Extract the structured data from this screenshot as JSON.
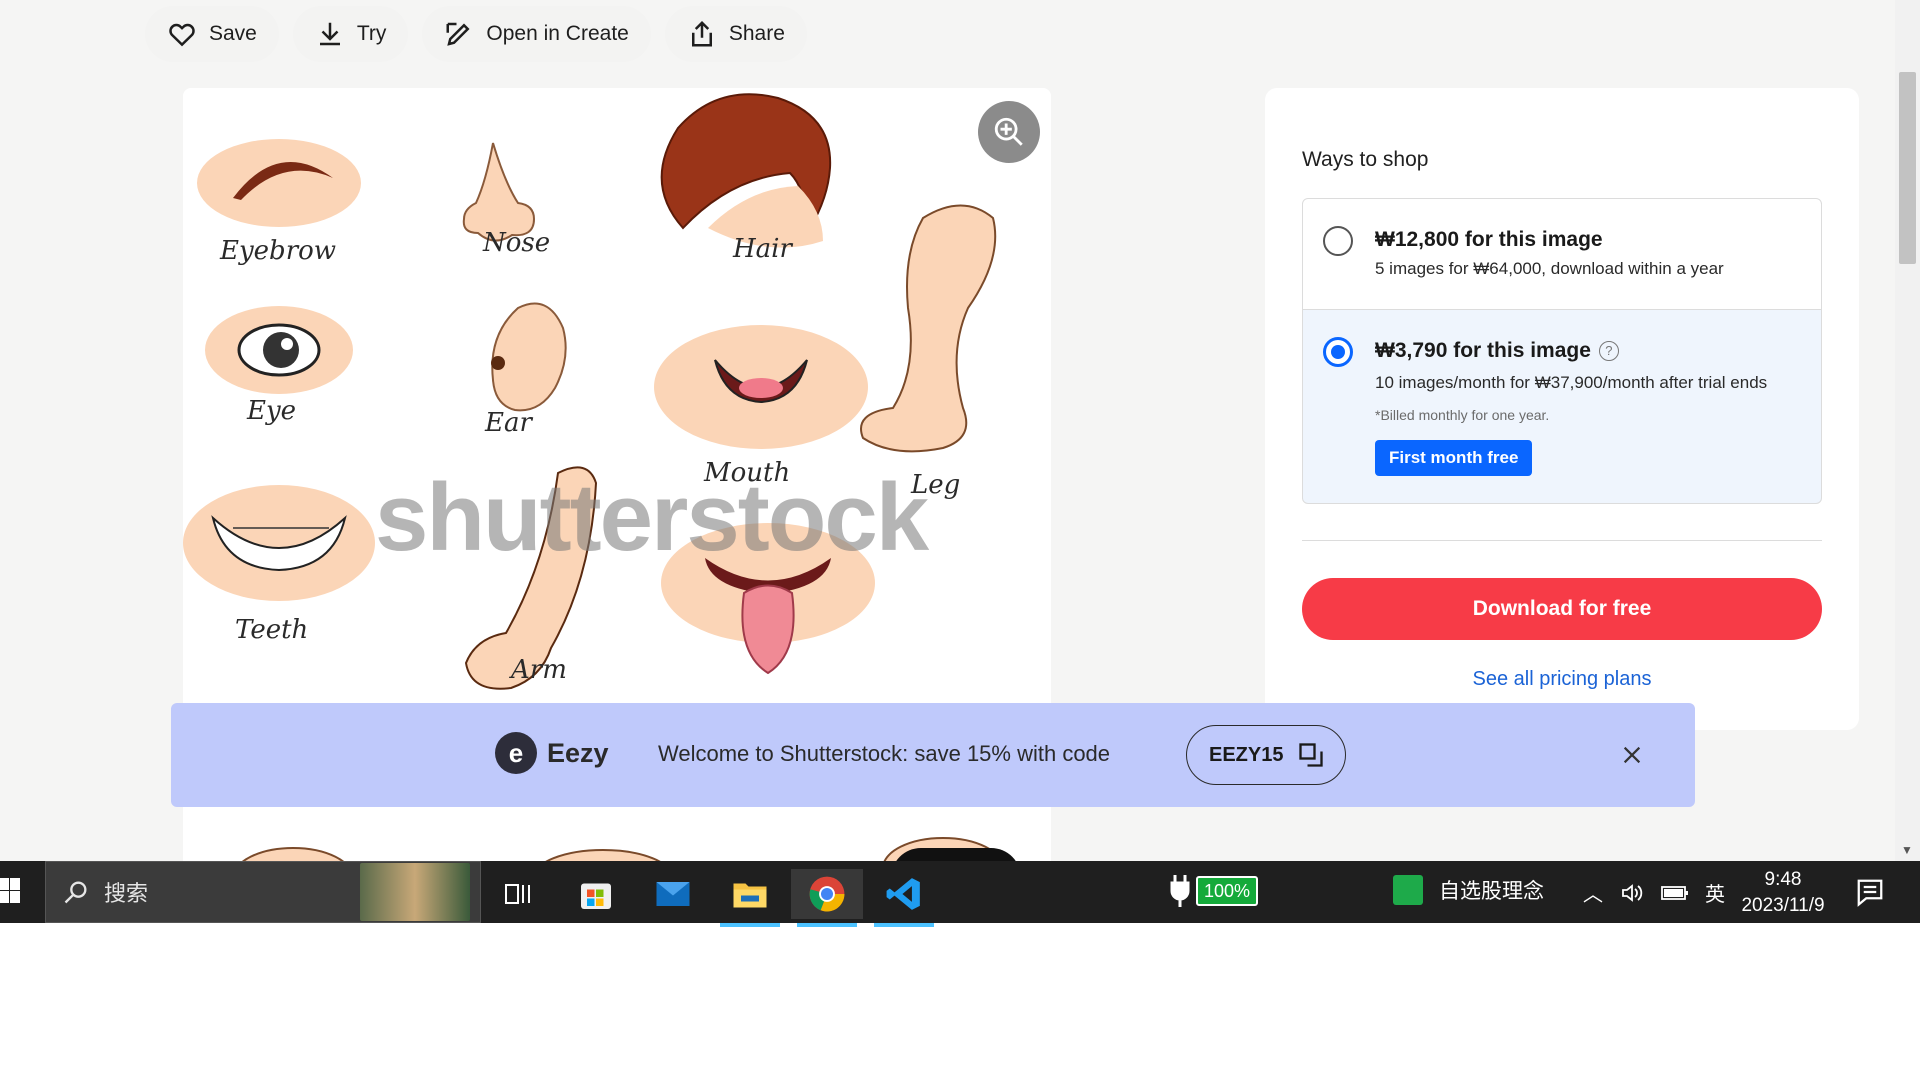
{
  "toolbar": {
    "save": "Save",
    "try": "Try",
    "open_in_create": "Open in Create",
    "share": "Share"
  },
  "image": {
    "labels": {
      "eyebrow": "Eyebrow",
      "nose": "Nose",
      "hair": "Hair",
      "eye": "Eye",
      "ear": "Ear",
      "mouth": "Mouth",
      "leg": "Leg",
      "teeth": "Teeth",
      "arm": "Arm"
    },
    "watermark": "shutterstock"
  },
  "shop": {
    "title": "Ways to shop",
    "option1": {
      "price": "₩12,800 for this image",
      "sub": "5 images for ₩64,000, download within a year"
    },
    "option2": {
      "price": "₩3,790 for this image",
      "sub": "10 images/month for ₩37,900/month after trial ends",
      "note": "*Billed monthly for one year.",
      "trial_button": "First month free"
    },
    "download_button": "Download for free",
    "pricing_link": "See all pricing plans"
  },
  "promo": {
    "brand": "Eezy",
    "text": "Welcome to Shutterstock: save 15% with code",
    "code": "EEZY15"
  },
  "taskbar": {
    "search_placeholder": "搜索",
    "battery": "100%",
    "stock_app": "自选股理念",
    "ime": "英",
    "time": "9:48",
    "date": "2023/11/9"
  },
  "colors": {
    "accent_blue": "#0a66ff",
    "download_red": "#f73b47",
    "promo_bg": "#bfc9fb",
    "link_blue": "#1b63d6"
  }
}
